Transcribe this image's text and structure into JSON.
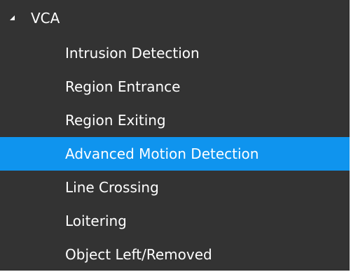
{
  "tree": {
    "root": {
      "label": "VCA",
      "expand_icon": "triangle-expanded-icon"
    },
    "children": [
      "Intrusion Detection",
      "Region Entrance",
      "Region Exiting",
      "Advanced Motion Detection",
      "Line Crossing",
      "Loitering",
      "Object Left/Removed"
    ],
    "selected_item": "Advanced Motion Detection"
  },
  "colors": {
    "background": "#333333",
    "selection": "#0f94ee",
    "text": "#ffffff",
    "border": "#ffffff"
  }
}
